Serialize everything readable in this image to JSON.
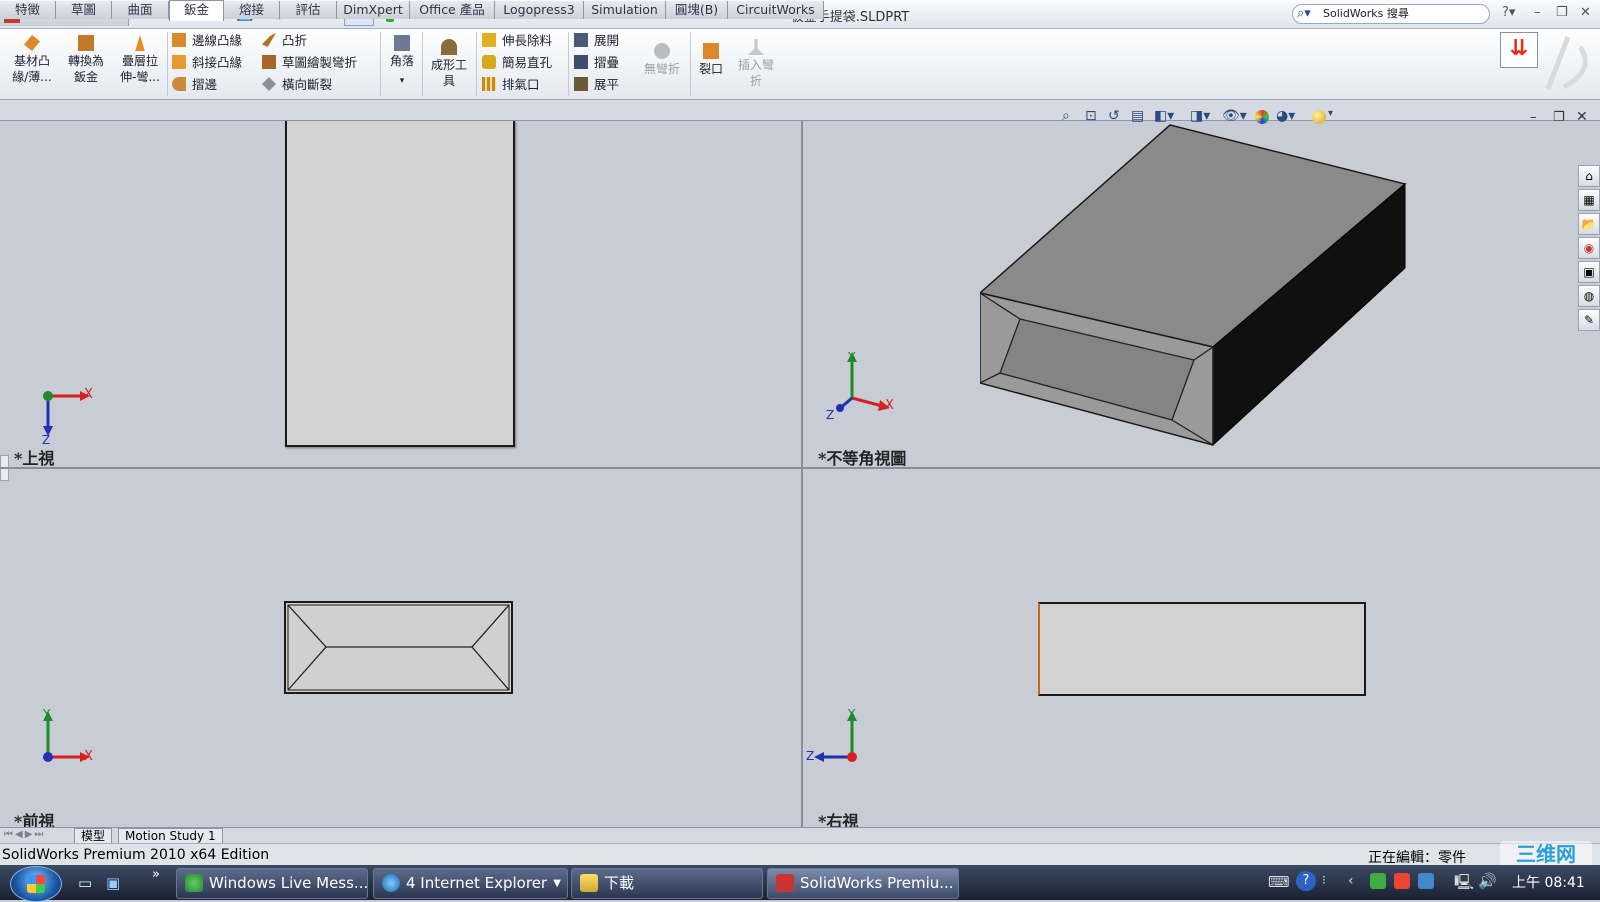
{
  "app": {
    "logo_text": "SolidWorks",
    "document_title": "板金手提袋.SLDPRT",
    "search_placeholder": "SolidWorks 搜尋",
    "help": "?"
  },
  "ribbon": {
    "big_left": [
      {
        "label": "基材凸\n緣/薄..."
      },
      {
        "label": "轉換為\n鈑金"
      },
      {
        "label": "疊層拉\n伸-彎..."
      }
    ],
    "col1": [
      "邊線凸緣",
      "斜接凸緣",
      "摺邊"
    ],
    "col2": [
      "凸折",
      "草圖繪製彎折",
      "橫向斷裂"
    ],
    "corner": "角落",
    "forming_tool": "成形工\n具",
    "col3": [
      "伸長除料",
      "簡易直孔",
      "排氣口"
    ],
    "col4": [
      "展開",
      "摺疊",
      "展平"
    ],
    "no_bends": "無彎折",
    "rip": "裂口",
    "insert_bends": "插入彎\n折"
  },
  "tabs": [
    {
      "label": "特徵"
    },
    {
      "label": "草圖"
    },
    {
      "label": "曲面"
    },
    {
      "label": "鈑金"
    },
    {
      "label": "熔接"
    },
    {
      "label": "評估"
    },
    {
      "label": "DimXpert"
    },
    {
      "label": "Office 產品"
    },
    {
      "label": "Logopress3"
    },
    {
      "label": "Simulation"
    },
    {
      "label": "圓塊(B)"
    },
    {
      "label": "CircuitWorks"
    }
  ],
  "active_tab": "鈑金",
  "viewports": {
    "top": "*上視",
    "iso": "*不等角視圖",
    "front": "*前視",
    "right": "*右視"
  },
  "axes": {
    "x": "X",
    "y": "Y",
    "z": "Z"
  },
  "bottom_tabs": [
    "模型",
    "Motion Study 1"
  ],
  "status": {
    "left": "SolidWorks Premium 2010 x64 Edition",
    "right": "正在編輯：零件"
  },
  "taskbar": {
    "items": [
      "Windows Live Mess...",
      "4 Internet Explorer",
      "下載",
      "SolidWorks Premiu..."
    ],
    "clock": "上午 08:41",
    "watermark": "三维网"
  },
  "colors": {
    "viewport_bg": "#c8ccd4",
    "axis_x": "#d42020",
    "axis_y": "#1f8a2a",
    "axis_z": "#2030b0"
  }
}
